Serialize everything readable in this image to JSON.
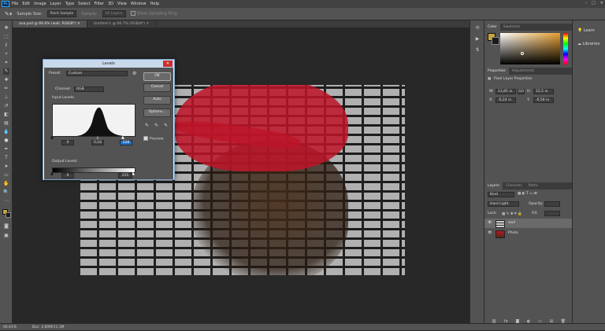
{
  "menu": {
    "logo": "Ps",
    "items": [
      "File",
      "Edit",
      "Image",
      "Layer",
      "Type",
      "Select",
      "Filter",
      "3D",
      "View",
      "Window",
      "Help"
    ]
  },
  "options": {
    "sample_size_label": "Sample Size:",
    "sample_size_value": "Point Sample",
    "sample_label": "Sample:",
    "sample_value": "All Layers",
    "show_ring": "Show Sampling Ring"
  },
  "tabs": [
    {
      "label": "ana.psd @ 66.6% (wall, RGB/8*)"
    },
    {
      "label": "Untitled-1 @ 66.7% (RGB/8*)"
    }
  ],
  "status": {
    "zoom": "66.61%",
    "doc": "Doc: 4,80M/11,3M"
  },
  "levels": {
    "title": "Levels",
    "preset_label": "Preset:",
    "preset_value": "Custom",
    "channel_label": "Channel:",
    "channel_value": "RGB",
    "input_label": "Input Levels:",
    "input_black": "0",
    "input_gamma": "0,54",
    "input_white": "228",
    "output_label": "Output Levels:",
    "output_black": "0",
    "output_white": "255",
    "ok": "OK",
    "cancel": "Cancel",
    "auto": "Auto",
    "options": "Options...",
    "preview": "Preview"
  },
  "panels": {
    "color_tabs": [
      "Color",
      "Swatches"
    ],
    "prop_tabs": [
      "Properties",
      "Adjustments"
    ],
    "prop_title": "Pixel Layer Properties",
    "w": "13,85 in",
    "h": "15,5 in",
    "x": "-0,24 in",
    "y": "-0,56 in",
    "w_label": "W:",
    "h_label": "H:",
    "x_label": "X:",
    "y_label": "Y:",
    "go": "GO",
    "layer_tabs": [
      "Layers",
      "Channels",
      "Paths"
    ],
    "kind": "Kind",
    "blend": "Hard Light",
    "opacity_label": "Opacity:",
    "fill_label": "Fill:",
    "lock_label": "Lock:",
    "layers": [
      {
        "name": "wall"
      },
      {
        "name": "Photo"
      }
    ]
  },
  "learn": {
    "learn": "Learn",
    "libraries": "Libraries"
  },
  "colors": {
    "accent": "#31a8ff",
    "cap_red": "#be1428"
  }
}
